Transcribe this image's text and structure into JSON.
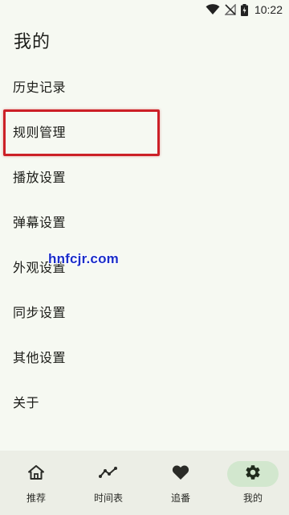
{
  "status_bar": {
    "time": "10:22",
    "icons": [
      "wifi-icon",
      "no-signal-icon",
      "battery-charging-icon"
    ]
  },
  "page": {
    "title": "我的"
  },
  "menu": {
    "items": [
      {
        "label": "历史记录",
        "name": "history"
      },
      {
        "label": "规则管理",
        "name": "rule-management"
      },
      {
        "label": "播放设置",
        "name": "playback-settings"
      },
      {
        "label": "弹幕设置",
        "name": "danmaku-settings"
      },
      {
        "label": "外观设置",
        "name": "appearance-settings"
      },
      {
        "label": "同步设置",
        "name": "sync-settings"
      },
      {
        "label": "其他设置",
        "name": "other-settings"
      },
      {
        "label": "关于",
        "name": "about"
      }
    ],
    "highlighted": "规则管理"
  },
  "watermark": {
    "text": "hnfcjr.com"
  },
  "bottom_nav": {
    "items": [
      {
        "label": "推荐",
        "icon": "home-icon",
        "active": false
      },
      {
        "label": "时间表",
        "icon": "timeline-icon",
        "active": false
      },
      {
        "label": "追番",
        "icon": "heart-icon",
        "active": false
      },
      {
        "label": "我的",
        "icon": "gear-icon",
        "active": true
      }
    ]
  },
  "colors": {
    "background": "#f6f9f2",
    "nav_background": "#eceee6",
    "active_pill": "#d2e7ce",
    "highlight_border": "#cc2027",
    "watermark": "#1b2ec9"
  }
}
